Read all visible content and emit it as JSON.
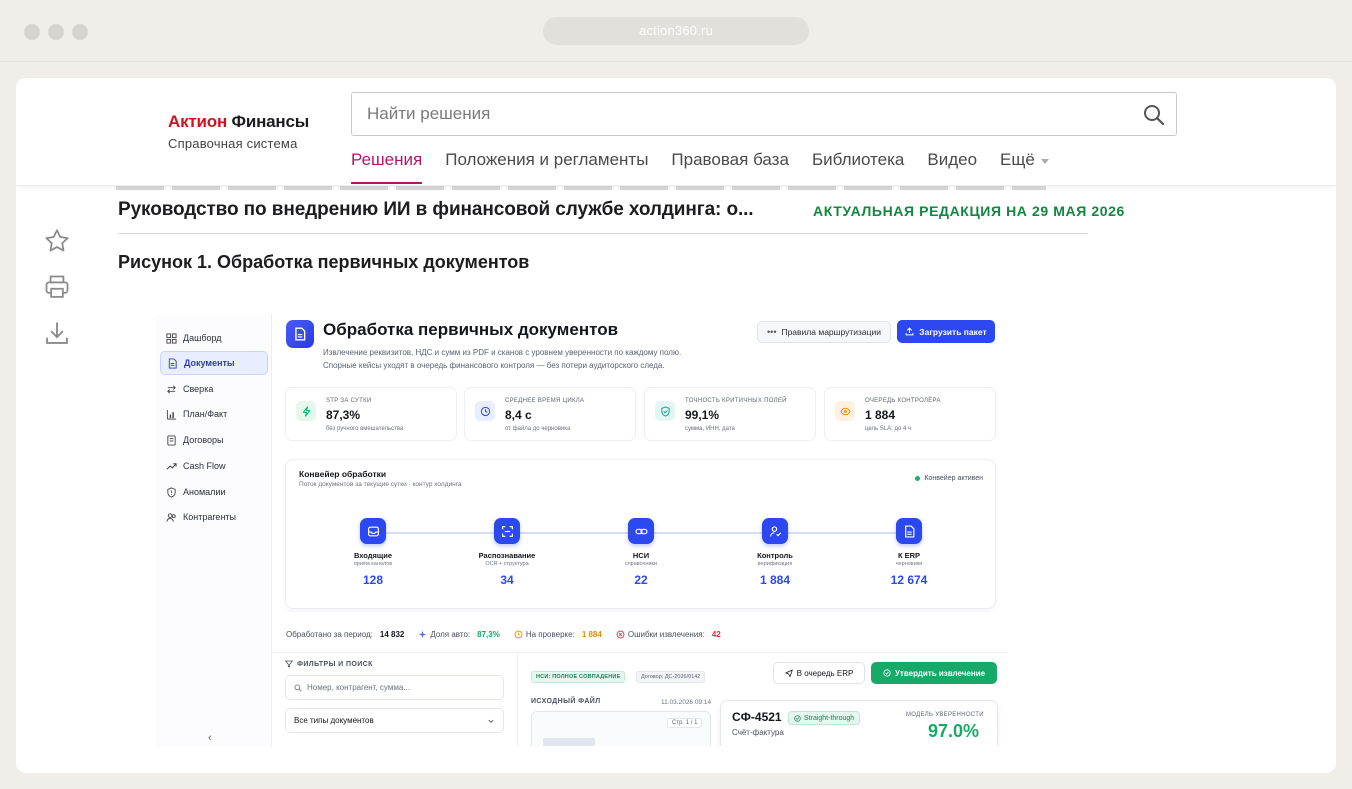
{
  "browser": {
    "url": "action360.ru"
  },
  "header": {
    "logo_primary": "Актион",
    "logo_secondary": "Финансы",
    "logo_sub": "Справочная система",
    "search_placeholder": "Найти решения",
    "nav": [
      "Решения",
      "Положения и регламенты",
      "Правовая база",
      "Библиотека",
      "Видео",
      "Ещё"
    ]
  },
  "document": {
    "title": "Руководство по внедрению ИИ в финансовой службе холдинга: о...",
    "edition": "АКТУАЛЬНАЯ РЕДАКЦИЯ НА 29 МАЯ 2026",
    "figure_caption": "Рисунок 1. Обработка первичных документов"
  },
  "side_tools": [
    "star-icon",
    "print-icon",
    "download-icon"
  ],
  "figure": {
    "sidebar": {
      "items": [
        {
          "label": "Дашборд",
          "icon": "grid-icon"
        },
        {
          "label": "Документы",
          "icon": "document-icon",
          "active": true
        },
        {
          "label": "Сверка",
          "icon": "swap-icon"
        },
        {
          "label": "План/Факт",
          "icon": "bar-chart-icon"
        },
        {
          "label": "Договоры",
          "icon": "contract-icon"
        },
        {
          "label": "Cash Flow",
          "icon": "trend-icon"
        },
        {
          "label": "Аномалии",
          "icon": "shield-icon"
        },
        {
          "label": "Контрагенты",
          "icon": "users-icon"
        }
      ],
      "collapse_label": "‹"
    },
    "title": "Обработка первичных документов",
    "description_1": "Извлечение реквизитов, НДС и сумм из PDF и сканов с уровнем уверенности по каждому полю.",
    "description_2": "Спорные кейсы уходят в очередь финансового контроля — без потери аудиторского следа.",
    "btn_rules": "Правила маршрутизации",
    "btn_upload": "Загрузить пакет",
    "kpis": [
      {
        "label": "STP за сутки",
        "value": "87,3%",
        "sub": "без ручного вмешательства",
        "color": "#e6f7ee",
        "icon_color": "#17a968"
      },
      {
        "label": "Среднее время цикла",
        "value": "8,4 с",
        "sub": "от файла до черновика",
        "color": "#e8edff",
        "icon_color": "#2c48f0"
      },
      {
        "label": "Точность критичных полей",
        "value": "99,1%",
        "sub": "сумма, ИНН, дата",
        "color": "#e3f6f4",
        "icon_color": "#13a38f"
      },
      {
        "label": "Очередь контролёра",
        "value": "1 884",
        "sub": "цель SLA: до 4 ч",
        "color": "#fff1df",
        "icon_color": "#e58a12"
      }
    ],
    "pipeline": {
      "title": "Конвейер обработки",
      "subtitle": "Поток документов за текущие сутки · контур холдинга",
      "status": "Конвейер активен",
      "stages": [
        {
          "name": "Входящие",
          "sub": "приём каналов",
          "count": "128"
        },
        {
          "name": "Распознавание",
          "sub": "OCR + структура",
          "count": "34"
        },
        {
          "name": "НСИ",
          "sub": "справочники",
          "count": "22"
        },
        {
          "name": "Контроль",
          "sub": "верификация",
          "count": "1 884"
        },
        {
          "name": "К ERP",
          "sub": "черновики",
          "count": "12 674"
        }
      ]
    },
    "stats": {
      "processed_label": "Обработано за период:",
      "processed_value": "14 832",
      "auto_label": "Доля авто:",
      "auto_value": "87,3%",
      "review_label": "На проверке:",
      "review_value": "1 884",
      "errors_label": "Ошибки извлечения:",
      "errors_value": "42"
    },
    "filters": {
      "title": "ФИЛЬТРЫ И ПОИСК",
      "search_placeholder": "Номер, контрагент, сумма...",
      "type_select": "Все типы документов"
    },
    "detail": {
      "tag_match": "НСИ: ПОЛНОЕ СОВПАДЕНИЕ",
      "tag_contract": "Договор: ДС-2026/0142",
      "btn_erp": "В очередь ERP",
      "btn_approve": "Утвердить извлечение",
      "source_label": "ИСХОДНЫЙ ФАЙЛ",
      "source_date": "11.03.2026 09:14",
      "page_chip": "Стр. 1 / 1",
      "doc_id": "СФ-4521",
      "doc_badge": "Straight-through",
      "doc_type": "Счёт-фактура",
      "confidence_label": "МОДЕЛЬ УВЕРЕННОСТИ",
      "confidence_value": "97.0%"
    }
  }
}
